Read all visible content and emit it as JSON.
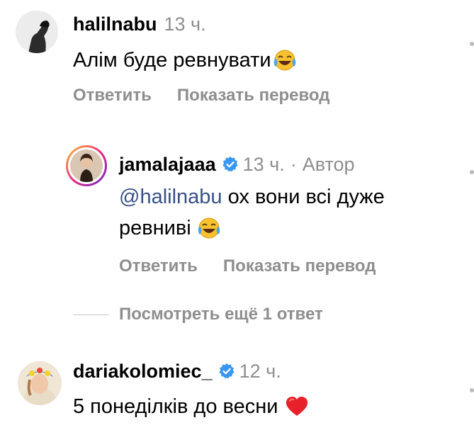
{
  "comments": [
    {
      "username": "halilnabu",
      "time": "13 ч.",
      "text": "Алім буде ревнувати",
      "reply_label": "Ответить",
      "translate_label": "Показать перевод"
    },
    {
      "username": "jamalajaaa",
      "time": "13 ч.",
      "separator": "·",
      "author_badge": "Автор",
      "mention": "@halilnabu",
      "text_line1": "ох вони всі дуже",
      "text_line2": "ревниві",
      "reply_label": "Ответить",
      "translate_label": "Показать перевод"
    },
    {
      "username": "dariakolomiec_",
      "time": "12 ч.",
      "text": "5 понеділків до весни"
    }
  ],
  "view_more_replies": "Посмотреть ещё 1 ответ",
  "colors": {
    "verified": "#3897f0",
    "mention": "#385185",
    "muted": "#8e8e8e"
  },
  "icons": [
    "joy-emoji-icon",
    "verified-badge-icon",
    "red-heart-emoji-icon"
  ]
}
